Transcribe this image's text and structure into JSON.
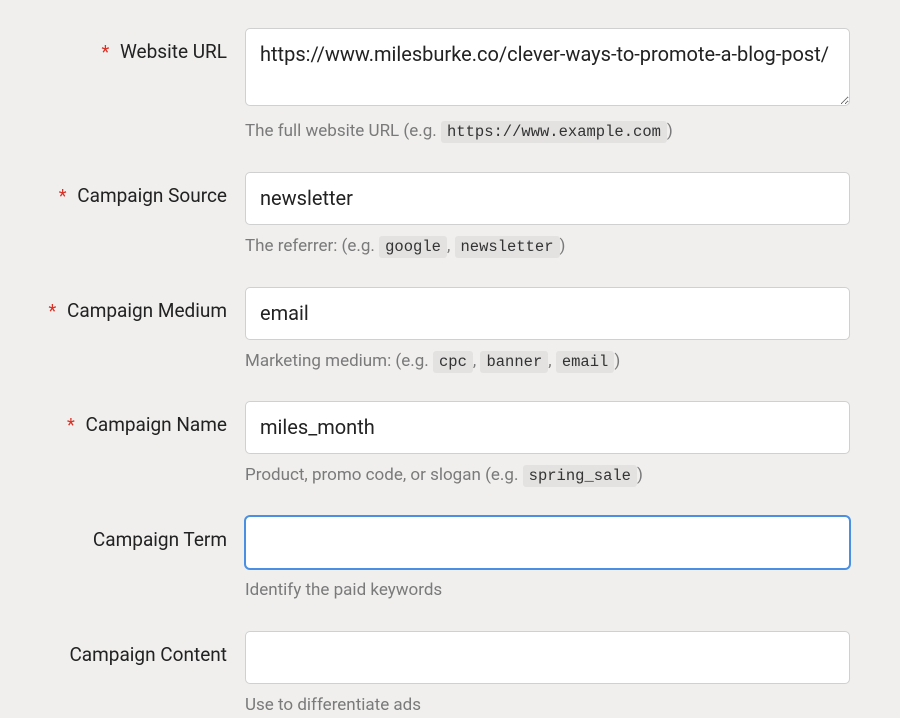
{
  "fields": {
    "website_url": {
      "label": "Website URL",
      "required": true,
      "value": "https://www.milesburke.co/clever-ways-to-promote-a-blog-post/",
      "help_prefix": "The full website URL (e.g. ",
      "help_codes": [
        "https://www.example.com"
      ],
      "help_suffix": ")"
    },
    "campaign_source": {
      "label": "Campaign Source",
      "required": true,
      "value": "newsletter",
      "help_prefix": "The referrer: (e.g. ",
      "help_codes": [
        "google",
        "newsletter"
      ],
      "help_suffix": ")"
    },
    "campaign_medium": {
      "label": "Campaign Medium",
      "required": true,
      "value": "email",
      "help_prefix": "Marketing medium: (e.g. ",
      "help_codes": [
        "cpc",
        "banner",
        "email"
      ],
      "help_suffix": ")"
    },
    "campaign_name": {
      "label": "Campaign Name",
      "required": true,
      "value": "miles_month",
      "help_prefix": "Product, promo code, or slogan (e.g. ",
      "help_codes": [
        "spring_sale"
      ],
      "help_suffix": ")"
    },
    "campaign_term": {
      "label": "Campaign Term",
      "required": false,
      "value": "",
      "help_prefix": "Identify the paid keywords",
      "help_codes": [],
      "help_suffix": ""
    },
    "campaign_content": {
      "label": "Campaign Content",
      "required": false,
      "value": "",
      "help_prefix": "Use to differentiate ads",
      "help_codes": [],
      "help_suffix": ""
    }
  },
  "required_marker": "*"
}
